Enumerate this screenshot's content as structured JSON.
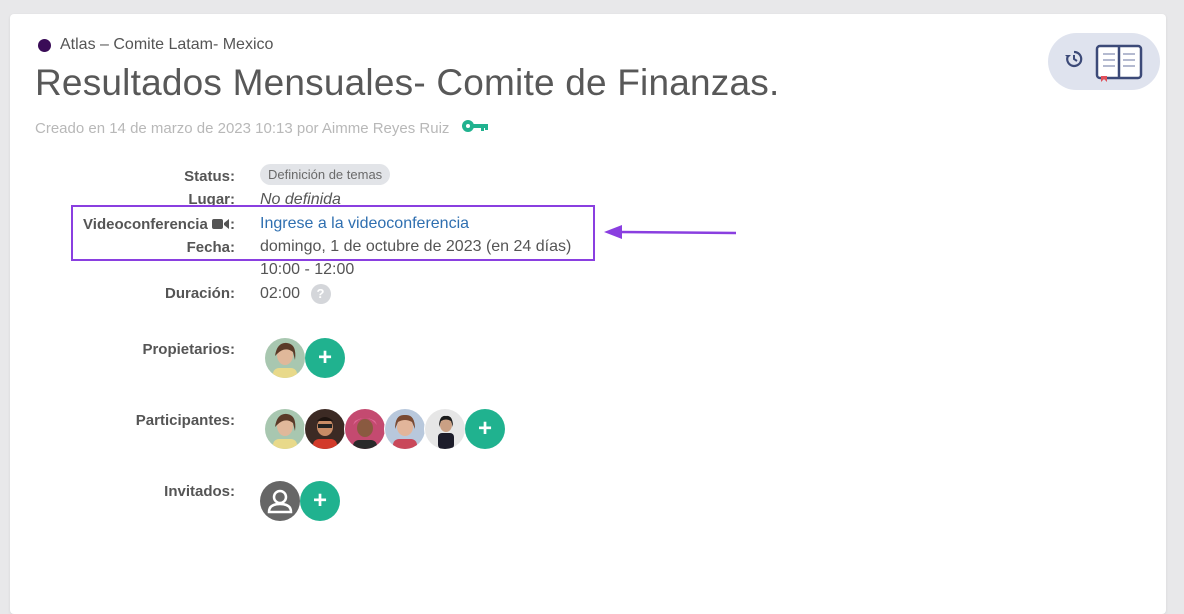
{
  "breadcrumb": {
    "text": "Atlas – Comite Latam- Mexico",
    "dot_color": "#3a0c57"
  },
  "title": "Resultados Mensuales- Comite de Finanzas.",
  "created": "Creado en 14 de marzo de 2023 10:13 por Aimme Reyes Ruiz",
  "accent_color": "#20b28f",
  "details": {
    "status_label": "Status:",
    "status_value": "Definición de temas",
    "lugar_label": "Lugar:",
    "lugar_value": "No definida",
    "video_label": "Videoconferencia",
    "video_link": "Ingrese a la videoconferencia",
    "fecha_label": "Fecha:",
    "fecha_value": "domingo, 1 de octubre de 2023  (en 24 días)",
    "time_value": "10:00 - 12:00",
    "duracion_label": "Duración:",
    "duracion_value": "02:00",
    "help_symbol": "?"
  },
  "people": {
    "propietarios_label": "Propietarios:",
    "participantes_label": "Participantes:",
    "invitados_label": "Invitados:",
    "add_symbol": "+"
  },
  "icons": [
    "circle-dot-icon",
    "key-icon",
    "history-icon",
    "book-icon",
    "video-camera-icon",
    "question-icon",
    "plus-icon",
    "person-icon"
  ],
  "annotation": {
    "box_color": "#8a3fe0"
  }
}
